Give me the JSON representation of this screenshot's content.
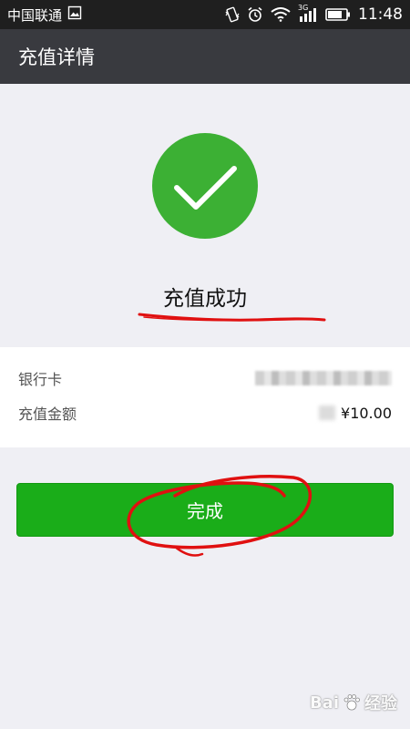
{
  "status_bar": {
    "carrier": "中国联通",
    "network": "3G",
    "time": "11:48",
    "icons": [
      "image-icon",
      "vibrate-icon",
      "alarm-icon",
      "wifi-icon",
      "signal-icon",
      "battery-icon"
    ]
  },
  "header": {
    "title": "充值详情"
  },
  "result": {
    "icon": "checkmark-icon",
    "title": "充值成功",
    "color": "#3cb034"
  },
  "details": {
    "bank_card_label": "银行卡",
    "amount_label": "充值金额",
    "amount_value": "¥10.00"
  },
  "actions": {
    "done_label": "完成",
    "color": "#1aad19"
  },
  "annotations": {
    "color": "#e01010"
  },
  "watermark": {
    "text": "Bai",
    "text2": "经验"
  }
}
